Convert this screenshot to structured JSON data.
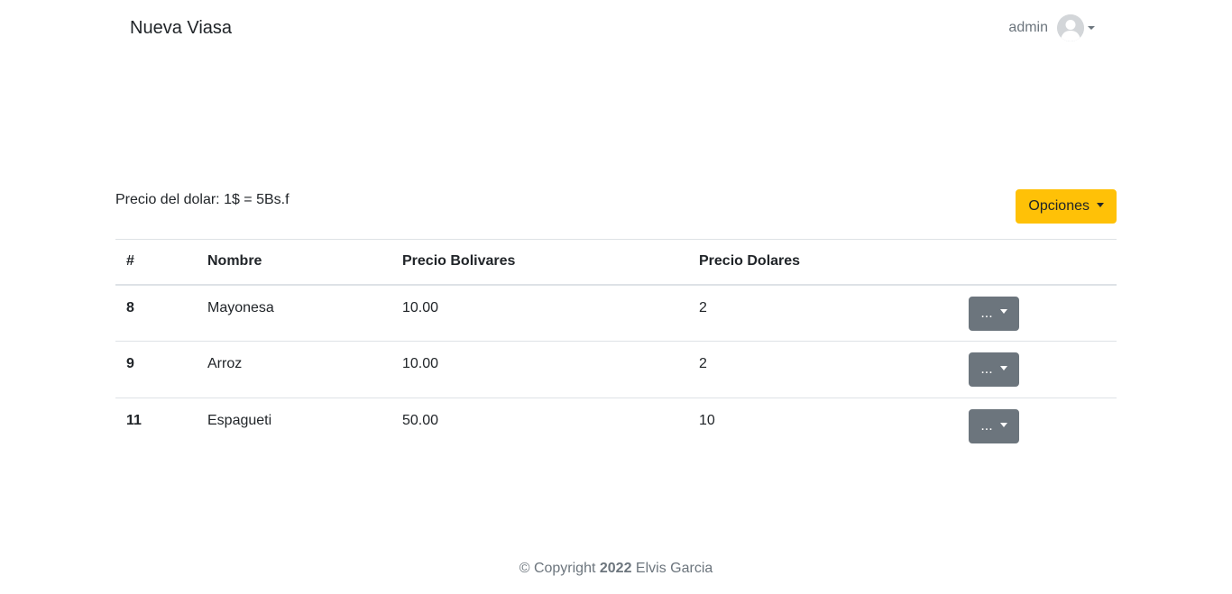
{
  "navbar": {
    "brand": "Nueva Viasa",
    "user": "admin",
    "avatar_icon": "user-avatar-icon"
  },
  "main": {
    "dolar_label": "Precio del dolar: 1$ = 5Bs.f",
    "options_button": "Opciones",
    "table": {
      "headers": [
        "#",
        "Nombre",
        "Precio Bolivares",
        "Precio Dolares",
        ""
      ],
      "rows": [
        {
          "id": "8",
          "nombre": "Mayonesa",
          "bolivares": "10.00",
          "dolares": "2",
          "action": "..."
        },
        {
          "id": "9",
          "nombre": "Arroz",
          "bolivares": "10.00",
          "dolares": "2",
          "action": "..."
        },
        {
          "id": "11",
          "nombre": "Espagueti",
          "bolivares": "50.00",
          "dolares": "10",
          "action": "..."
        }
      ]
    }
  },
  "footer": {
    "prefix": "© Copyright",
    "year": "2022",
    "author": "Elvis Garcia"
  },
  "colors": {
    "options_button": "#ffc107",
    "action_button": "#6c757d",
    "muted_text": "#6c757d"
  }
}
